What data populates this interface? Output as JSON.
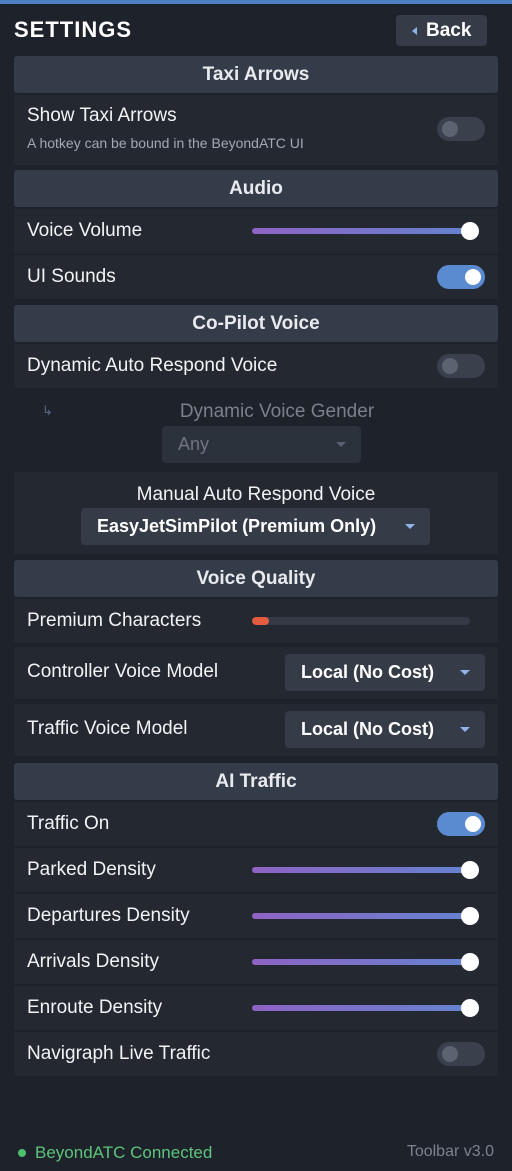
{
  "header": {
    "title": "SETTINGS",
    "back_label": "Back"
  },
  "taxi": {
    "title": "Taxi Arrows",
    "show_label": "Show Taxi Arrows",
    "show_hint": "A hotkey can be bound in the BeyondATC UI",
    "show_on": false
  },
  "audio": {
    "title": "Audio",
    "voice_volume_label": "Voice Volume",
    "voice_volume_value": 1.0,
    "ui_sounds_label": "UI Sounds",
    "ui_sounds_on": true
  },
  "copilot": {
    "title": "Co-Pilot Voice",
    "dynamic_label": "Dynamic Auto Respond Voice",
    "dynamic_on": false,
    "gender_label": "Dynamic Voice Gender",
    "gender_value": "Any",
    "manual_label": "Manual Auto Respond Voice",
    "manual_value": "EasyJetSimPilot (Premium Only)"
  },
  "quality": {
    "title": "Voice Quality",
    "premium_label": "Premium Characters",
    "premium_fraction": 0.08,
    "controller_label": "Controller Voice Model",
    "controller_value": "Local (No Cost)",
    "traffic_label": "Traffic Voice Model",
    "traffic_value": "Local (No Cost)"
  },
  "ai_traffic": {
    "title": "AI Traffic",
    "traffic_on_label": "Traffic On",
    "traffic_on": true,
    "parked_label": "Parked Density",
    "parked_value": 1.0,
    "departures_label": "Departures Density",
    "departures_value": 1.0,
    "arrivals_label": "Arrivals Density",
    "arrivals_value": 1.0,
    "enroute_label": "Enroute Density",
    "enroute_value": 1.0,
    "navigraph_label": "Navigraph Live Traffic",
    "navigraph_on": false
  },
  "footer": {
    "status": "BeyondATC Connected",
    "version": "Toolbar v3.0"
  },
  "colors": {
    "accent": "#5a8ad0",
    "status_green": "#5ec47b",
    "premium_bar": "#e45b3f"
  }
}
